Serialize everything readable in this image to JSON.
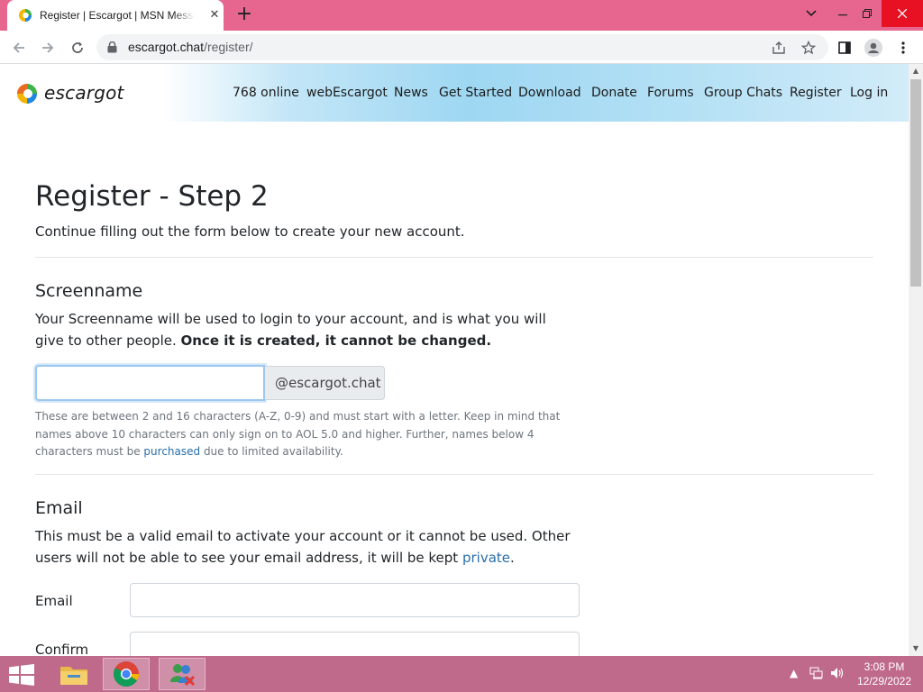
{
  "browser": {
    "tab_title": "Register | Escargot | MSN Messenger",
    "tab_close": "✕",
    "new_tab": "+",
    "url_host": "escargot.chat",
    "url_path": "/register/",
    "window": {
      "minimize": "⌄",
      "restore": "−",
      "maximize": "❐",
      "close": "✕"
    }
  },
  "site": {
    "logo_text": "escargot",
    "nav": [
      "768 online",
      "webEscargot",
      "News",
      "Get Started",
      "Download",
      "Donate",
      "Forums",
      "Group Chats",
      "Register",
      "Log in"
    ]
  },
  "page": {
    "title": "Register - Step 2",
    "lead": "Continue filling out the form below to create your new account.",
    "screenname": {
      "heading": "Screenname",
      "desc": "Your Screenname will be used to login to your account, and is what you will give to other people. ",
      "desc_bold": "Once it is created, it cannot be changed.",
      "input_value": "",
      "addon": "@escargot.chat",
      "help": "These are between 2 and 16 characters (A-Z, 0-9) and must start with a letter. Keep in mind that names above 10 characters can only sign on to AOL 5.0 and higher. Further, names below 4 characters must be ",
      "help_link": "purchased",
      "help_end": " due to limited availability."
    },
    "email": {
      "heading": "Email",
      "desc": "This must be a valid email to activate your account or it cannot be used. Other users will not be able to see your email address, it will be kept ",
      "desc_link": "private",
      "desc_end": ".",
      "email_label": "Email",
      "confirm_label": "Confirm",
      "email_value": "",
      "confirm_value": ""
    }
  },
  "taskbar": {
    "time": "3:08 PM",
    "date": "12/29/2022"
  },
  "colors": {
    "tabstrip": "#e6668f",
    "taskbar": "#bf6a8b",
    "link": "#2a6ea8",
    "header_accent": "#9ed7f2"
  }
}
